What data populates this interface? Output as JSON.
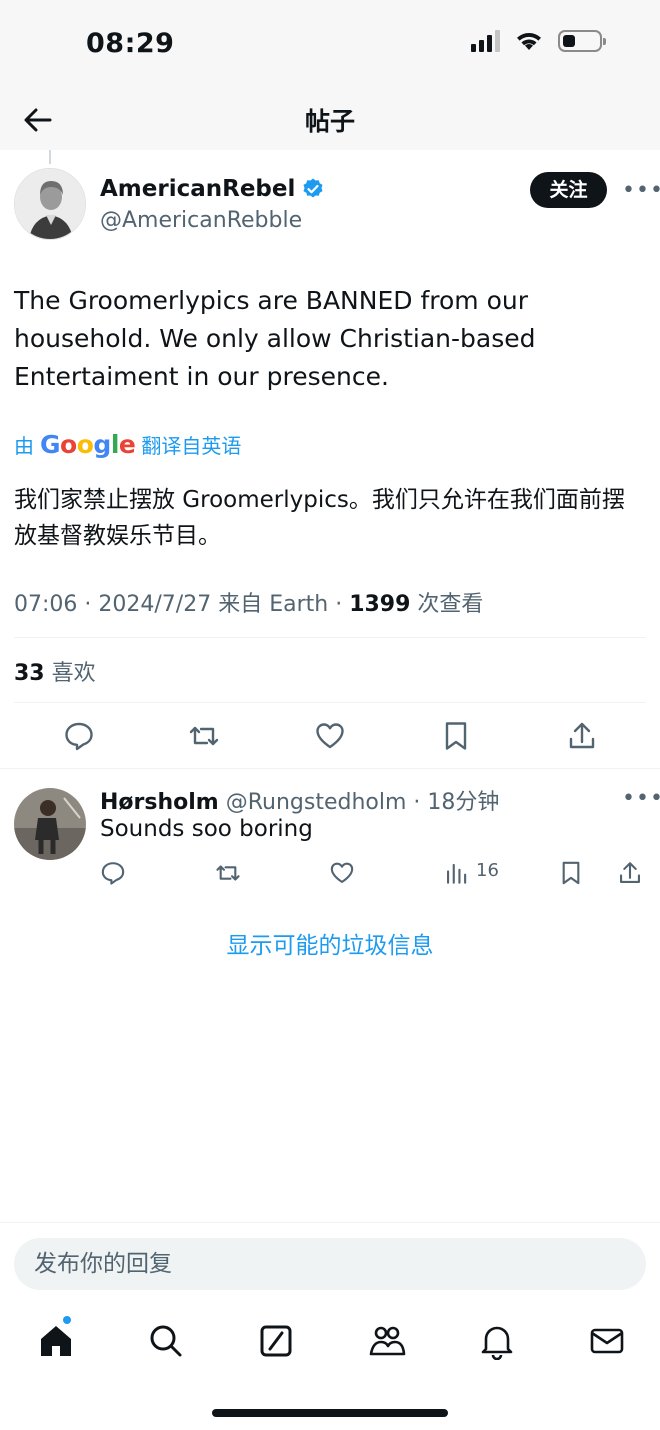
{
  "status_bar": {
    "time": "08:29"
  },
  "header": {
    "title": "帖子"
  },
  "tweet": {
    "author_name": "AmericanRebel",
    "author_handle": "@AmericanRebble",
    "follow_label": "关注",
    "text": "The Groomerlypics are BANNED from our household. We only allow Christian-based Entertaiment in our presence.",
    "translation": {
      "prefix": "由",
      "provider": "Google",
      "suffix": "翻译自英语",
      "text": "我们家禁止摆放 Groomerlypics。我们只允许在我们面前摆放基督教娱乐节目。"
    },
    "meta": {
      "time": "07:06",
      "date": "2024/7/27",
      "location": "来自 Earth",
      "views": "1399",
      "views_label": "次查看"
    },
    "likes": {
      "count": "33",
      "label": "喜欢"
    }
  },
  "reply": {
    "name": "Hørsholm",
    "handle": "@Rungstedholm",
    "time": "18分钟",
    "text": "Sounds soo boring",
    "views": "16"
  },
  "spam_link": "显示可能的垃圾信息",
  "reply_input": {
    "placeholder": "发布你的回复"
  },
  "colors": {
    "accent": "#1d9bf0",
    "text_primary": "#0f1419",
    "text_secondary": "#536471",
    "divider": "#eff3f4"
  }
}
